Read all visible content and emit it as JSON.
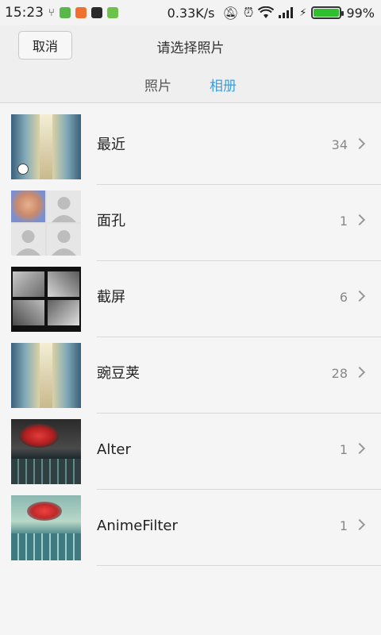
{
  "status_bar": {
    "time": "15:23",
    "net_speed": "0.33K/s",
    "battery": "99%",
    "battery_level": 0.99,
    "icons": [
      "usb-icon",
      "app-icon",
      "app-icon",
      "download-icon",
      "android-icon",
      "mute-icon",
      "alarm-icon",
      "wifi-icon",
      "signal-icon",
      "charging-icon"
    ]
  },
  "header": {
    "cancel_label": "取消",
    "title": "请选择照片",
    "tabs": [
      {
        "label": "照片",
        "active": false
      },
      {
        "label": "相册",
        "active": true
      }
    ]
  },
  "albums": [
    {
      "name": "最近",
      "count": "34"
    },
    {
      "name": "面孔",
      "count": "1"
    },
    {
      "name": "截屏",
      "count": "6"
    },
    {
      "name": "豌豆荚",
      "count": "28"
    },
    {
      "name": "Alter",
      "count": "1"
    },
    {
      "name": "AnimeFilter",
      "count": "1"
    }
  ],
  "colors": {
    "accent": "#3a9ede",
    "battery_green": "#2fbf2f"
  }
}
